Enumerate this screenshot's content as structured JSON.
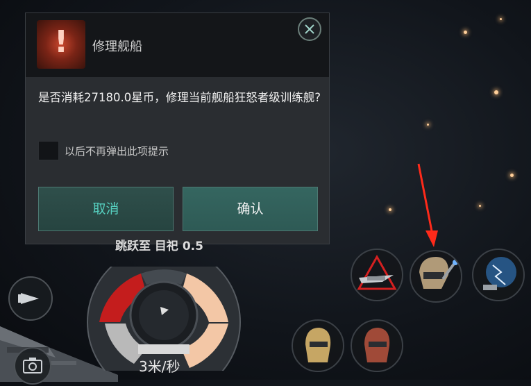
{
  "dialog": {
    "title": "修理舰船",
    "message": "是否消耗27180.0星币，修理当前舰船狂怒者级训练舰?",
    "checkbox_label": "以后不再弹出此项提示",
    "cancel_label": "取消",
    "confirm_label": "确认"
  },
  "hud": {
    "warp_label": "跳跃至 目祀 0.5",
    "speed_label": "3米/秒"
  },
  "colors": {
    "accent_teal": "#56d0c0",
    "alert_red": "#c8462d",
    "annotation_red": "#ff2a1a"
  },
  "icons": {
    "close": "close-icon",
    "alert": "exclamation-icon",
    "camera": "camera-icon",
    "left_btn": "ship-formation-icon"
  }
}
